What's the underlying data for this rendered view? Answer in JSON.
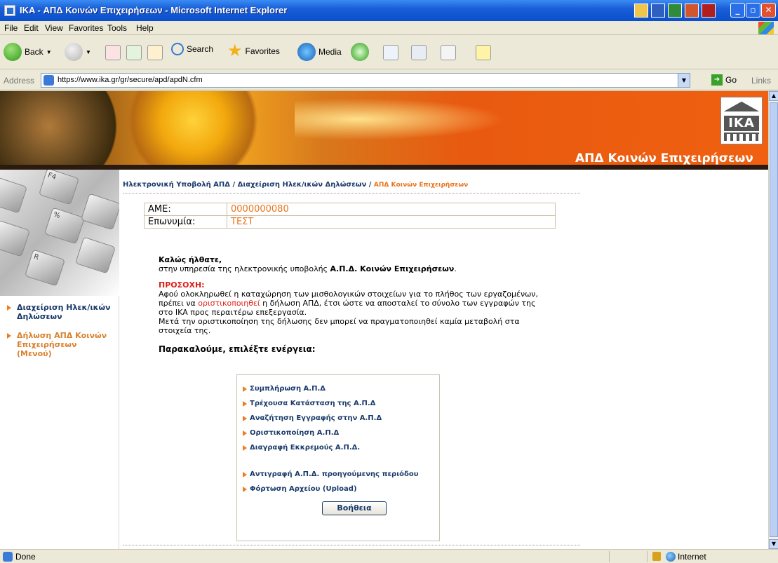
{
  "window": {
    "title": "IKA - ΑΠΔ Κοινών Επιχειρήσεων - Microsoft Internet Explorer"
  },
  "menu": [
    "File",
    "Edit",
    "View",
    "Favorites",
    "Tools",
    "Help"
  ],
  "toolbar": {
    "back": "Back",
    "search": "Search",
    "favorites": "Favorites",
    "media": "Media"
  },
  "address": {
    "label": "Address",
    "url": "https://www.ika.gr/gr/secure/apd/apdN.cfm",
    "go": "Go",
    "links": "Links"
  },
  "banner": {
    "logo_text": "ΙΚΑ",
    "app_name": "ΑΠΔ Κοινών Επιχειρήσεων"
  },
  "sidebar": {
    "items": [
      {
        "label": "Διαχείριση Ηλεκ/ικών Δηλώσεων"
      },
      {
        "label": "Δήλωση ΑΠΔ Κοινών Επιχειρήσεων (Μενού)"
      }
    ]
  },
  "breadcrumb": {
    "part1": "Ηλεκτρονική Υποβολή ΑΠΔ",
    "sep": " / ",
    "part2": "Διαχείριση Ηλεκ/ικών Δηλώσεων",
    "current": "ΑΠΔ Κοινών Επιχειρήσεων"
  },
  "employer": {
    "ame_label": "ΑΜΕ:",
    "ame_value": "0000000080",
    "name_label": "Επωνυμία:",
    "name_value": "ΤΕΣΤ"
  },
  "welcome": {
    "greeting": "Καλώς ήλθατε,",
    "line_prefix": "στην υπηρεσία της ηλεκτρονικής υποβολής ",
    "line_bold": "Α.Π.Δ. Κοινών Επιχειρήσεων",
    "line_suffix": ".",
    "warning_title": "ΠΡΟΣΟΧΗ:",
    "warning_part1": "Αφού ολοκληρωθεί η καταχώρηση των μισθολογικών στοιχείων για το πλήθος των εργαζομένων, πρέπει να ",
    "warning_highlight": "οριστικοποιηθεί",
    "warning_part2": " η δήλωση ΑΠΔ, έτσι ώστε να αποσταλεί το σύνολο των εγγραφών της στο ΙΚΑ προς περαιτέρω επεξεργασία.",
    "warning_part3": "Μετά την οριστικοποίηση της δήλωσης δεν μπορεί να πραγματοποιηθεί καμία μεταβολή στα στοιχεία της.",
    "choose": "Παρακαλούμε, επιλέξτε ενέργεια:"
  },
  "actions": [
    {
      "label": "Συμπλήρωση Α.Π.Δ"
    },
    {
      "label": "Τρέχουσα Κατάσταση της Α.Π.Δ"
    },
    {
      "label": "Αναζήτηση Εγγραφής στην Α.Π.Δ"
    },
    {
      "label": "Οριστικοποίηση Α.Π.Δ"
    },
    {
      "label": "Διαγραφή Εκκρεμούς Α.Π.Δ."
    },
    {
      "label": "Αντιγραφή Α.Π.Δ. προηγούμενης περιόδου"
    },
    {
      "label": "Φόρτωση Αρχείου (Upload)"
    }
  ],
  "help_button": "Βοήθεια",
  "status": {
    "text": "Done",
    "zone": "Internet"
  },
  "colors": {
    "accent_orange": "#e8731c",
    "nav_blue": "#1a3a6a",
    "warning_red": "#e0201a",
    "xp_title_blue": "#0a4fcc"
  }
}
